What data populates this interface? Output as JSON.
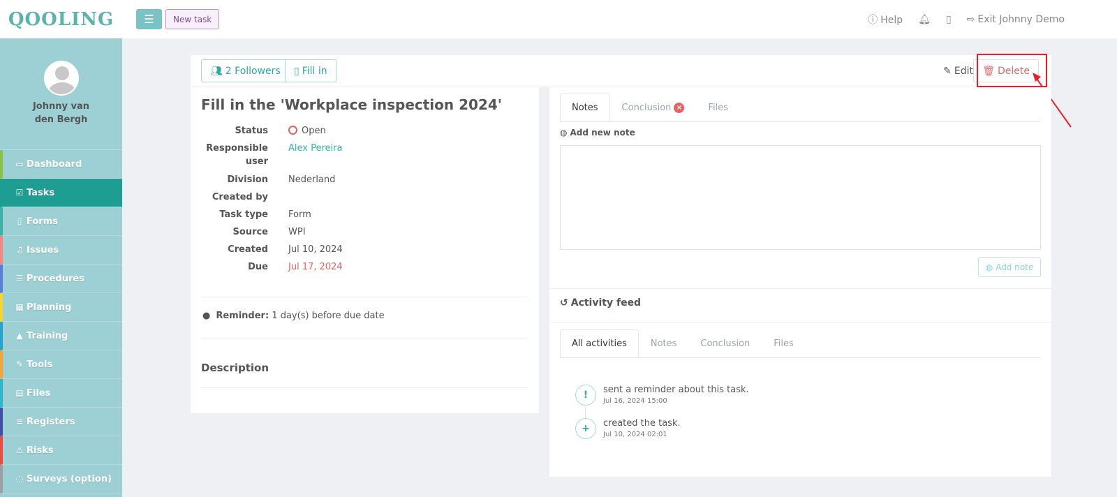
{
  "app": {
    "logo": "QOOLING"
  },
  "user": {
    "name": "Johnny van den Bergh"
  },
  "sidebar": {
    "items": [
      {
        "label": "Dashboard",
        "icon": "monitor-icon",
        "accent": "#8bc34a"
      },
      {
        "label": "Tasks",
        "icon": "check-square-icon",
        "accent": "#1e9e93"
      },
      {
        "label": "Forms",
        "icon": "file-icon",
        "accent": "#3fb2a8"
      },
      {
        "label": "Issues",
        "icon": "bell-icon",
        "accent": "#f08a80"
      },
      {
        "label": "Procedures",
        "icon": "list-icon",
        "accent": "#5b7fd6"
      },
      {
        "label": "Planning",
        "icon": "calendar-icon",
        "accent": "#f2d338"
      },
      {
        "label": "Training",
        "icon": "graduation-cap-icon",
        "accent": "#29a3c6"
      },
      {
        "label": "Tools",
        "icon": "wrench-icon",
        "accent": "#f0a63a"
      },
      {
        "label": "Files",
        "icon": "file-text-icon",
        "accent": "#30b7c7"
      },
      {
        "label": "Registers",
        "icon": "list-icon",
        "accent": "#4150a8"
      },
      {
        "label": "Risks",
        "icon": "warning-icon",
        "accent": "#e84c3d"
      },
      {
        "label": "Surveys (option)",
        "icon": "comment-icon",
        "accent": "#9aa0a6"
      }
    ]
  },
  "topbar": {
    "new_task": "New task",
    "help": "Help",
    "exit": "Exit Johnny Demo"
  },
  "header": {
    "followers": "2 Followers",
    "fill_in": "Fill in",
    "edit": "Edit",
    "delete": "Delete"
  },
  "task": {
    "title": "Fill in the 'Workplace inspection 2024'",
    "labels": {
      "status": "Status",
      "responsible": "Responsible user",
      "division": "Division",
      "created_by": "Created by",
      "task_type": "Task type",
      "source": "Source",
      "created": "Created",
      "due": "Due"
    },
    "values": {
      "status": "Open",
      "responsible": "Alex Pereira",
      "division": "Nederland",
      "created_by": "",
      "task_type": "Form",
      "source": "WPI",
      "created": "Jul 10, 2024",
      "due": "Jul 17, 2024"
    },
    "reminder_label": "Reminder:",
    "reminder_text": "1 day(s) before due date",
    "description_heading": "Description"
  },
  "notes_panel": {
    "tabs": [
      "Notes",
      "Conclusion",
      "Files"
    ],
    "add_new_note": "Add new note",
    "add_note_button": "Add note"
  },
  "activity": {
    "heading": "Activity feed",
    "tabs": [
      "All activities",
      "Notes",
      "Conclusion",
      "Files"
    ],
    "items": [
      {
        "icon": "!",
        "text": "sent a reminder about this task.",
        "time": "Jul 16, 2024 15:00"
      },
      {
        "icon": "+",
        "text": "created the task.",
        "time": "Jul 10, 2024 02:01"
      }
    ]
  },
  "colors": {
    "accent": "#1e9e93",
    "sidebar_bg": "#9dd0d4",
    "danger": "#e86161",
    "highlight": "#e8202a"
  }
}
